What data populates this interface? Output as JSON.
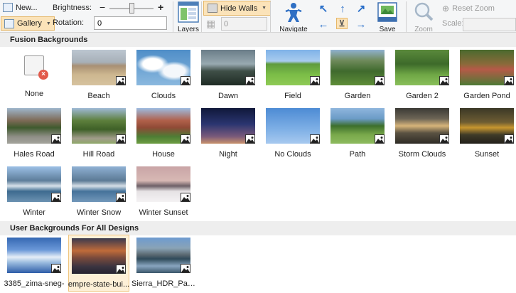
{
  "ribbon": {
    "new_label": "New...",
    "gallery_label": "Gallery",
    "brightness_label": "Brightness:",
    "brightness_minus": "−",
    "brightness_plus": "+",
    "rotation_label": "Rotation:",
    "rotation_value": "0",
    "layers_label": "Layers",
    "hide_walls_label": "Hide Walls",
    "wall_value": "0",
    "navigate_label": "Navigate",
    "save_label": "Save",
    "zoom_label": "Zoom",
    "reset_zoom_label": "Reset Zoom",
    "scale_label": "Scale:"
  },
  "sections": {
    "fusion": "Fusion Backgrounds",
    "user": "User Backgrounds For All Designs"
  },
  "fusion_backgrounds": [
    {
      "label": "None",
      "thumb": "none"
    },
    {
      "label": "Beach",
      "thumb": "beach"
    },
    {
      "label": "Clouds",
      "thumb": "clouds"
    },
    {
      "label": "Dawn",
      "thumb": "dawn"
    },
    {
      "label": "Field",
      "thumb": "field"
    },
    {
      "label": "Garden",
      "thumb": "garden"
    },
    {
      "label": "Garden 2",
      "thumb": "garden2"
    },
    {
      "label": "Garden Pond",
      "thumb": "pond"
    },
    {
      "label": "Hales Road",
      "thumb": "hales"
    },
    {
      "label": "Hill Road",
      "thumb": "hill"
    },
    {
      "label": "House",
      "thumb": "house"
    },
    {
      "label": "Night",
      "thumb": "night"
    },
    {
      "label": "No Clouds",
      "thumb": "noclouds"
    },
    {
      "label": "Path",
      "thumb": "path"
    },
    {
      "label": "Storm Clouds",
      "thumb": "storm"
    },
    {
      "label": "Sunset",
      "thumb": "sunset"
    },
    {
      "label": "Winter",
      "thumb": "winter"
    },
    {
      "label": "Winter Snow",
      "thumb": "wintersnow"
    },
    {
      "label": "Winter Sunset",
      "thumb": "wintersunset"
    }
  ],
  "user_backgrounds": [
    {
      "label": "3385_zima-sneg-",
      "thumb": "zima"
    },
    {
      "label": "empre-state-bui...",
      "thumb": "empire",
      "selected": true
    },
    {
      "label": "Sierra_HDR_Pan...",
      "thumb": "sierra"
    }
  ],
  "thumb_styles": {
    "beach": "linear-gradient(180deg,#bcc6d0 0%,#a7b0b8 35%,#a89074 45%,#cdb78f 70%,#d6c29e 100%)",
    "clouds": "radial-gradient(ellipse at 30% 40%,#ffffff 0 18%,transparent 30%),radial-gradient(ellipse at 70% 60%,#f4f7fb 0 20%,transparent 32%),linear-gradient(180deg,#4f8ec8,#8ab8de)",
    "dawn": "linear-gradient(180deg,#6a7d88 0%,#98a9b0 40%,#3f4f47 60%,#1f2c25 100%)",
    "field": "linear-gradient(180deg,#7fb2e8 0%,#a8cbee 32%,#5f9b3d 40%,#7bbd47 70%,#8fca55 100%)",
    "garden": "linear-gradient(180deg,#8fb1cf 0%,#6f8a5b 30%,#3f6a2d 60%,#5e8d38 100%)",
    "garden2": "linear-gradient(180deg,#5b8a3c 0%,#3d6a2a 40%,#6fa745 70%,#89bf5a 100%)",
    "pond": "linear-gradient(180deg,#4a6a2e 0%,#8a6a3a 40%,#b55a48 55%,#4d7a35 100%)",
    "hales": "linear-gradient(180deg,#9fb6cc 0%,#7d6a56 35%,#3f5a2e 55%,#8e8e86 80%,#a4a49c 100%)",
    "hill": "linear-gradient(180deg,#9fb9d6 0%,#5d7f3c 35%,#3e6027 60%,#a19c8a 85%,#8fa86a 100%)",
    "house": "linear-gradient(180deg,#9dbbe0 0%,#b0604a 35%,#8f4a36 55%,#4e7d35 80%,#6d9d42 100%)",
    "night": "linear-gradient(180deg,#10183a 0%,#2a3570 45%,#7a5a7a 80%,#c9926d 100%)",
    "noclouds": "linear-gradient(180deg,#4d8bd4 0%,#7fb0e6 60%,#a7c9ef 100%)",
    "path": "linear-gradient(180deg,#8fb6dd 0%,#6b9bc7 30%,#3d6f2c 50%,#79a94b 75%,#8dba5e 100%)",
    "storm": "linear-gradient(180deg,#3b3a35 0%,#6d6556 30%,#d6b47a 50%,#5a5242 70%,#2f2c26 100%)",
    "sunset": "linear-gradient(180deg,#3b3826 0%,#6e5d33 40%,#c7962f 55%,#3f3b28 75%,#23211a 100%)",
    "winter": "linear-gradient(180deg,#9cc0e6 0%,#5d7d9a 40%,#d8e2ea 55%,#3d6a8f 70%,#6d93b2 100%)",
    "wintersnow": "linear-gradient(180deg,#8fb1d4 0%,#5c7a95 40%,#d6dfe7 55%,#45729a 70%,#7398ba 100%)",
    "wintersunset": "linear-gradient(180deg,#c9a4a6 0%,#d7b8b4 40%,#6d5f66 55%,#e6e2e4 70%,#f4f2f3 100%)",
    "zima": "linear-gradient(180deg,#3568b3 0%,#6a98d8 35%,#e6eef7 55%,#9bbcdf 70%,#2d5da8 100%)",
    "empire": "linear-gradient(180deg,#3b3a4e 0%,#c06b3a 35%,#7a4a3b 55%,#3a3440 80%,#262330 100%)",
    "sierra": "linear-gradient(180deg,#6d9bd0 0%,#8aa3b6 30%,#5c6a72 48%,#2f4a5a 60%,#88a4bf 80%,#3a566a 100%)"
  }
}
